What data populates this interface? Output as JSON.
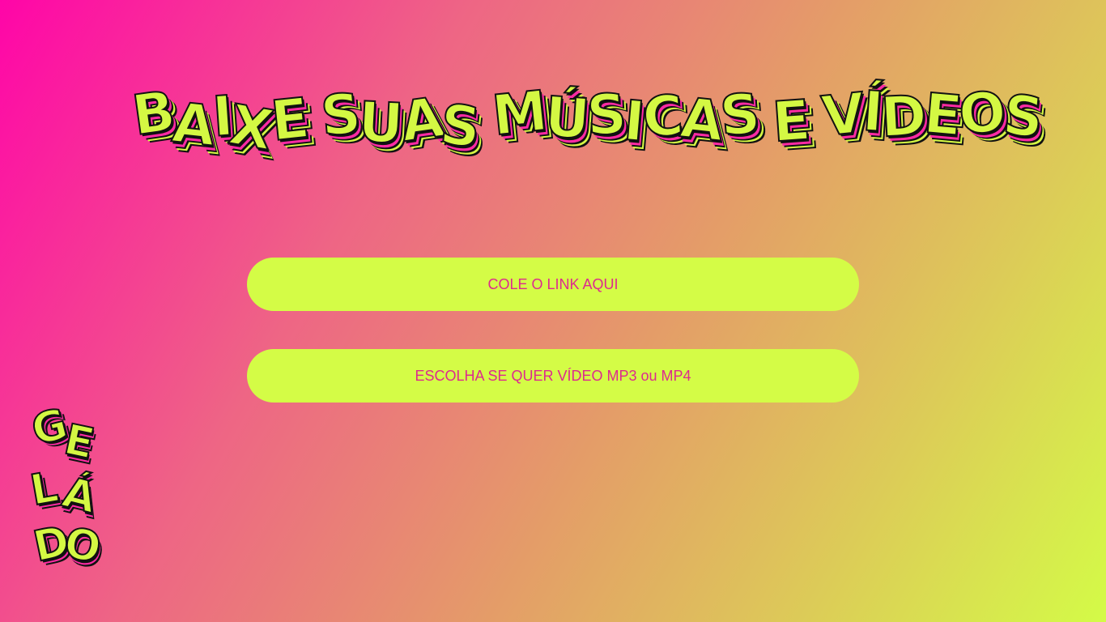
{
  "heading": {
    "words": [
      "BAIXE",
      "SUAS",
      "MÚSICAS",
      "E",
      "VÍDEOS"
    ]
  },
  "actions": {
    "link_label": "COLE O LINK AQUI",
    "format_label": "ESCOLHA SE QUER VÍDEO MP3 ou MP4"
  },
  "logo": {
    "letters": [
      "G",
      "E",
      "L",
      "Á",
      "D",
      "O"
    ]
  },
  "colors": {
    "gradient_start": "#ff05a8",
    "gradient_end": "#d4fb47",
    "button_fill": "#d4fc46",
    "button_text": "#dd2a8e",
    "title_fill": "#d4f843"
  }
}
